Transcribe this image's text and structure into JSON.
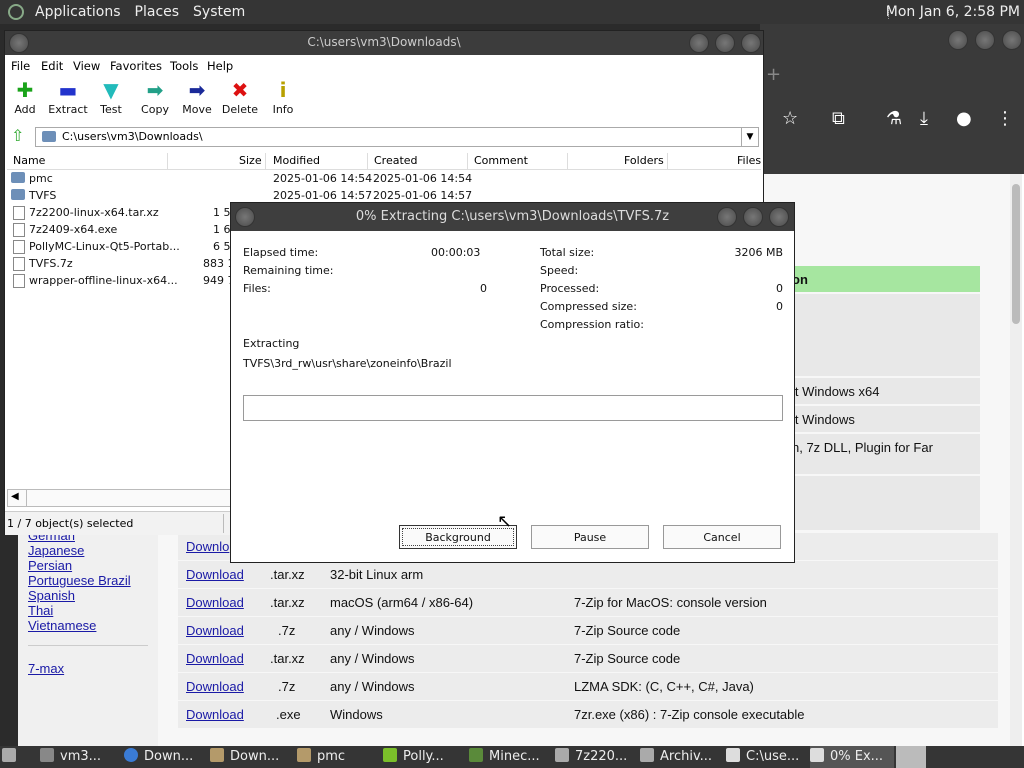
{
  "top_panel": {
    "menus": [
      "Applications",
      "Places",
      "System"
    ],
    "clock": "Mon Jan  6,  2:58 PM"
  },
  "webpage": {
    "languages": [
      "German",
      "Japanese",
      "Persian",
      "Portuguese Brazil",
      "Spanish",
      "Thai",
      "Vietnamese"
    ],
    "extra_link": "7-max",
    "partial_texts": [
      "on",
      "it Windows x64",
      "it Windows",
      "n, 7z DLL, Plugin for Far"
    ],
    "rows": [
      {
        "link": "Download",
        "type": ".tar.xz",
        "system": "32-bit Linux arm",
        "desc": ""
      },
      {
        "link": "Download",
        "type": ".tar.xz",
        "system": "macOS (arm64 / x86-64)",
        "desc": "7-Zip for MacOS: console version"
      },
      {
        "link": "Download",
        "type": ".7z",
        "system": "any / Windows",
        "desc": "7-Zip Source code"
      },
      {
        "link": "Download",
        "type": ".tar.xz",
        "system": "any / Windows",
        "desc": "7-Zip Source code"
      },
      {
        "link": "Download",
        "type": ".7z",
        "system": "any / Windows",
        "desc": "LZMA SDK: (C, C++, C#, Java)"
      },
      {
        "link": "Download",
        "type": ".exe",
        "system": "Windows",
        "desc": "7zr.exe (x86) : 7-Zip console executable"
      }
    ],
    "partial_row_link": "Downlo"
  },
  "file_manager": {
    "title": "C:\\users\\vm3\\Downloads\\",
    "menu": [
      "File",
      "Edit",
      "View",
      "Favorites",
      "Tools",
      "Help"
    ],
    "toolbar": [
      {
        "label": "Add",
        "glyph": "✚",
        "color": "#1aa31a"
      },
      {
        "label": "Extract",
        "glyph": "▬",
        "color": "#2233cc"
      },
      {
        "label": "Test",
        "glyph": "▼",
        "color": "#22bbbb"
      },
      {
        "label": "Copy",
        "glyph": "➡",
        "color": "#22a088"
      },
      {
        "label": "Move",
        "glyph": "➡",
        "color": "#1a2a99"
      },
      {
        "label": "Delete",
        "glyph": "✖",
        "color": "#dd1111"
      },
      {
        "label": "Info",
        "glyph": "i",
        "color": "#b8a000"
      }
    ],
    "path": "C:\\users\\vm3\\Downloads\\",
    "columns": [
      "Name",
      "Size",
      "Modified",
      "Created",
      "Comment",
      "Folders",
      "Files"
    ],
    "files": [
      {
        "name": "pmc",
        "size": "",
        "modified": "2025-01-06 14:54",
        "created": "2025-01-06 14:54",
        "kind": "folder"
      },
      {
        "name": "TVFS",
        "size": "",
        "modified": "2025-01-06 14:57",
        "created": "2025-01-06 14:57",
        "kind": "folder"
      },
      {
        "name": "7z2200-linux-x64.tar.xz",
        "size": "1 5",
        "modified": "",
        "created": "",
        "kind": "file"
      },
      {
        "name": "7z2409-x64.exe",
        "size": "1 6",
        "modified": "",
        "created": "",
        "kind": "file"
      },
      {
        "name": "PollyMC-Linux-Qt5-Portab...",
        "size": "6 5",
        "modified": "",
        "created": "",
        "kind": "file"
      },
      {
        "name": "TVFS.7z",
        "size": "883 1",
        "modified": "",
        "created": "",
        "kind": "file"
      },
      {
        "name": "wrapper-offline-linux-x64...",
        "size": "949 7",
        "modified": "",
        "created": "",
        "kind": "file"
      }
    ],
    "status": "1 / 7 object(s) selected"
  },
  "dialog": {
    "title": "0% Extracting C:\\users\\vm3\\Downloads\\TVFS.7z",
    "elapsed_label": "Elapsed time:",
    "elapsed_value": "00:00:03",
    "remaining_label": "Remaining time:",
    "files_label": "Files:",
    "files_value": "0",
    "total_size_label": "Total size:",
    "total_size_value": "3206 MB",
    "speed_label": "Speed:",
    "processed_label": "Processed:",
    "processed_value": "0",
    "compressed_label": "Compressed size:",
    "compressed_value": "0",
    "ratio_label": "Compression ratio:",
    "action": "Extracting",
    "current_file": "TVFS\\3rd_rw\\usr\\share\\zoneinfo\\Brazil",
    "progress": 0,
    "buttons": {
      "background": "Background",
      "pause": "Pause",
      "cancel": "Cancel"
    }
  },
  "taskbar": {
    "tasks": [
      "vm3...",
      "Down...",
      "Down...",
      "pmc",
      "Polly...",
      "Minec...",
      "7z220...",
      "Archiv...",
      "C:\\use...",
      "0% Ex..."
    ]
  }
}
